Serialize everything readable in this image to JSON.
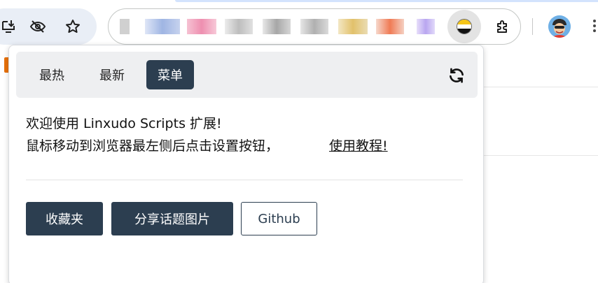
{
  "toolbar": {
    "icons": [
      "install-icon",
      "eye-off-icon",
      "star-icon",
      "extensions-puzzle-icon",
      "kebab-menu-icon"
    ],
    "blurred_url_colors": [
      "#d8d8d8",
      "#a9bfe8",
      "#f3a6bf",
      "#cfcfcf",
      "#bdbdbd",
      "#c9c9c9",
      "#ead08f",
      "#f4a98a",
      "#c9b8f5"
    ],
    "extension_colors": [
      "#f5c518",
      "#ffffff",
      "#111111"
    ]
  },
  "popup": {
    "tabs": [
      {
        "label": "最热",
        "active": false
      },
      {
        "label": "最新",
        "active": false
      },
      {
        "label": "菜单",
        "active": true
      }
    ],
    "refresh_icon": "refresh-icon",
    "welcome_line": "欢迎使用 Linxudo Scripts 扩展!",
    "instruction_line": "鼠标移动到浏览器最左侧后点击设置按钮，",
    "tutorial_link": "使用教程!",
    "buttons": {
      "favorites": "收藏夹",
      "share_image": "分享话题图片",
      "github": "Github"
    }
  },
  "colors": {
    "primary": "#2c3e50",
    "tabbar_bg": "#eeeff1"
  }
}
